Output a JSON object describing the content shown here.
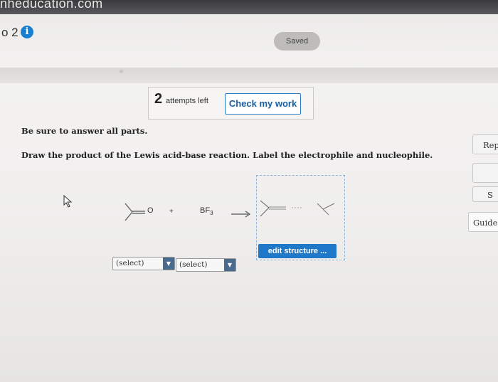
{
  "browser": {
    "url_fragment": "nheducation.com"
  },
  "header": {
    "question_number": "o 2",
    "info_icon": "info-icon",
    "saved_label": "Saved"
  },
  "attempts": {
    "count": "2",
    "label": "attempts left",
    "check_button": "Check my work"
  },
  "instructions": {
    "line1": "Be sure to answer all parts.",
    "line2": "Draw the product of the Lewis acid-base reaction. Label the electrophile and nucleophile."
  },
  "reaction": {
    "reactant_atom": "O",
    "plus": "+",
    "bf3_main": "BF",
    "bf3_sub": "3",
    "edit_button": "edit structure ..."
  },
  "selects": [
    {
      "value": "(select)"
    },
    {
      "value": "(select)"
    }
  ],
  "sidebar": {
    "rep_label": "Rep",
    "s_label": "S",
    "guide_label": "Guide"
  },
  "colors": {
    "accent": "#1f78c8",
    "info_blue": "#1b7fd0",
    "select_arrow": "#4a6b8c"
  }
}
